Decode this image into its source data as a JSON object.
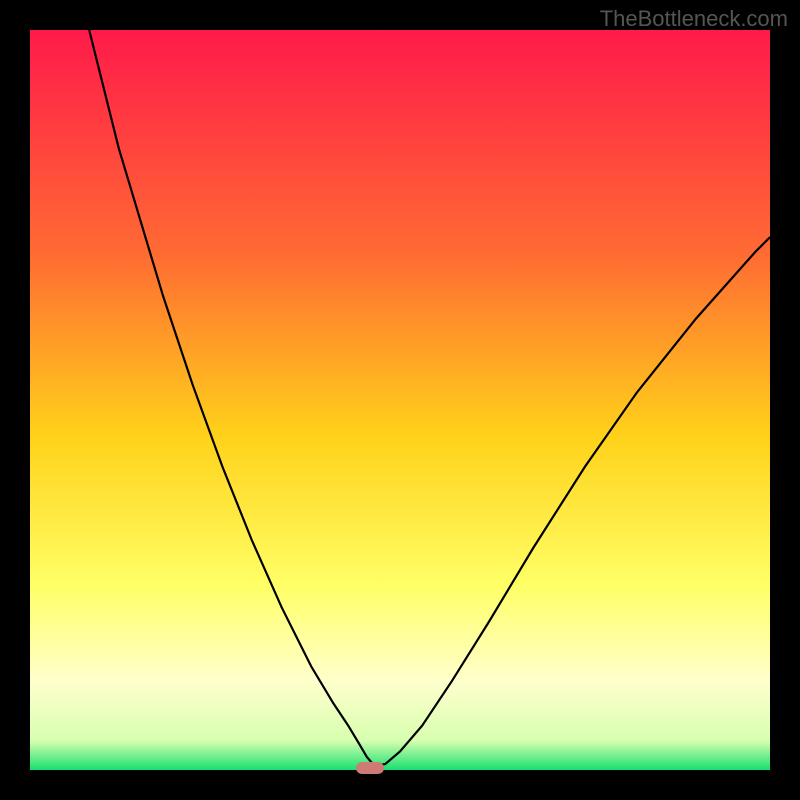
{
  "watermark": "TheBottleneck.com",
  "chart_data": {
    "type": "line",
    "title": "",
    "xlabel": "",
    "ylabel": "",
    "xlim": [
      0,
      100
    ],
    "ylim": [
      0,
      100
    ],
    "gradient_stops": [
      {
        "offset": 0,
        "color": "#ff1a4a"
      },
      {
        "offset": 30,
        "color": "#ff6a33"
      },
      {
        "offset": 55,
        "color": "#ffd21a"
      },
      {
        "offset": 75,
        "color": "#ffff66"
      },
      {
        "offset": 88,
        "color": "#ffffcc"
      },
      {
        "offset": 96,
        "color": "#d8ffb0"
      },
      {
        "offset": 100,
        "color": "#18e070"
      }
    ],
    "series": [
      {
        "name": "curve",
        "x": [
          8,
          10,
          12,
          15,
          18,
          22,
          26,
          30,
          34,
          38,
          41,
          43,
          44.5,
          45.5,
          46.5,
          48,
          50,
          53,
          57,
          62,
          68,
          75,
          82,
          90,
          98,
          100
        ],
        "y": [
          100,
          92,
          84,
          74,
          64,
          52,
          41,
          31,
          22,
          14,
          9,
          6,
          3.5,
          1.8,
          0.6,
          0.8,
          2.5,
          6,
          12,
          20,
          30,
          41,
          51,
          61,
          70,
          72
        ]
      }
    ],
    "marker": {
      "x": 46,
      "y": 0.3
    }
  }
}
